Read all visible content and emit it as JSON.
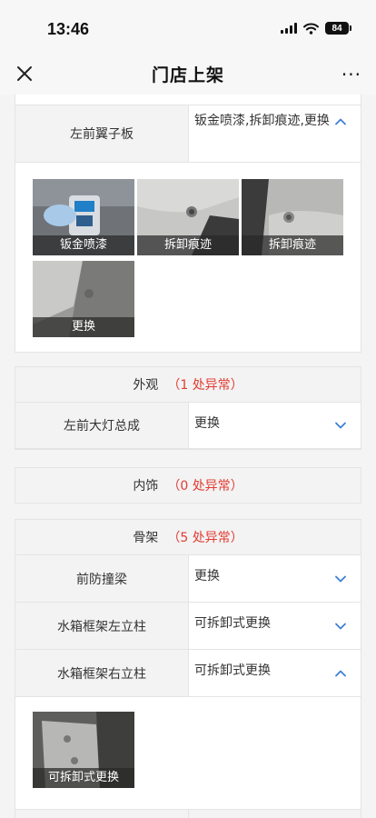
{
  "status": {
    "time": "13:46",
    "battery": "84"
  },
  "nav": {
    "title": "门店上架",
    "more": "···"
  },
  "panel_fender": {
    "label": "左前翼子板",
    "value": "钣金喷漆,拆卸痕迹,更换",
    "photos": [
      "钣金喷漆",
      "拆卸痕迹",
      "拆卸痕迹",
      "更换"
    ]
  },
  "section_exterior": {
    "name": "外观",
    "count": "1",
    "suffix": "处异常"
  },
  "row_headlight": {
    "label": "左前大灯总成",
    "value": "更换"
  },
  "section_interior": {
    "name": "内饰",
    "count": "0",
    "suffix": "处异常"
  },
  "section_frame": {
    "name": "骨架",
    "count": "5",
    "suffix": "处异常"
  },
  "row_bumper_beam": {
    "label": "前防撞梁",
    "value": "更换"
  },
  "row_radiator_left": {
    "label": "水箱框架左立柱",
    "value": "可拆卸式更换"
  },
  "row_radiator_right": {
    "label": "水箱框架右立柱",
    "value": "可拆卸式更换",
    "photos": [
      "可拆卸式更换"
    ]
  },
  "colors": {
    "accent": "#3d7fd6",
    "warning": "#e23b32",
    "label_bg": "#f3f3f3"
  },
  "icons": {
    "close": "close-icon",
    "expand": "chevron-down-icon",
    "collapse": "chevron-up-icon"
  }
}
